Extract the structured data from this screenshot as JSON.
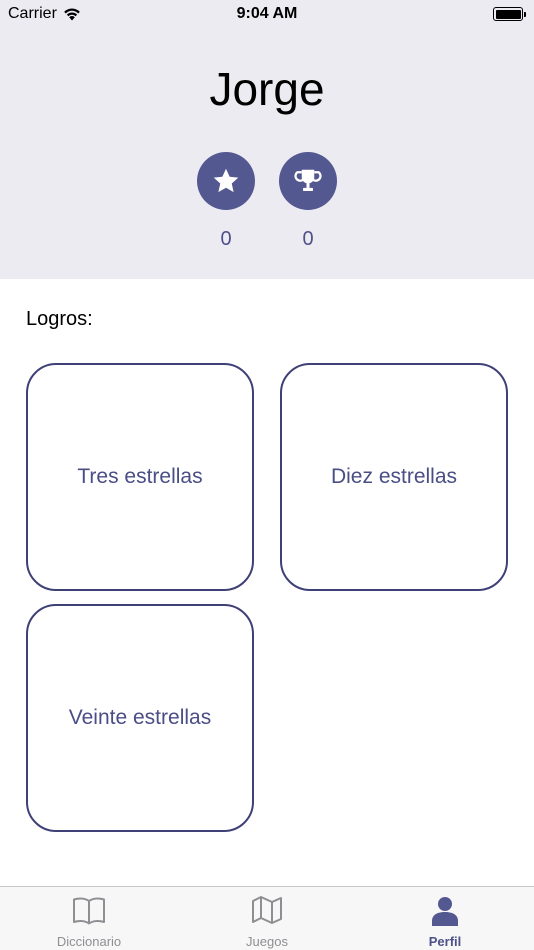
{
  "status_bar": {
    "carrier": "Carrier",
    "time": "9:04 AM"
  },
  "profile": {
    "name": "Jorge",
    "stars_count": "0",
    "trophies_count": "0"
  },
  "achievements": {
    "label": "Logros:",
    "items": [
      {
        "label": "Tres estrellas"
      },
      {
        "label": "Diez estrellas"
      },
      {
        "label": "Veinte estrellas"
      }
    ]
  },
  "tab_bar": {
    "tabs": [
      {
        "label": "Diccionario",
        "icon": "book-icon"
      },
      {
        "label": "Juegos",
        "icon": "map-icon"
      },
      {
        "label": "Perfil",
        "icon": "person-icon",
        "selected": true
      }
    ]
  },
  "colors": {
    "accent": "#545890",
    "header_bg": "#ecebf1",
    "card_border": "#3e4076",
    "inactive_tab": "#8e8e93"
  }
}
